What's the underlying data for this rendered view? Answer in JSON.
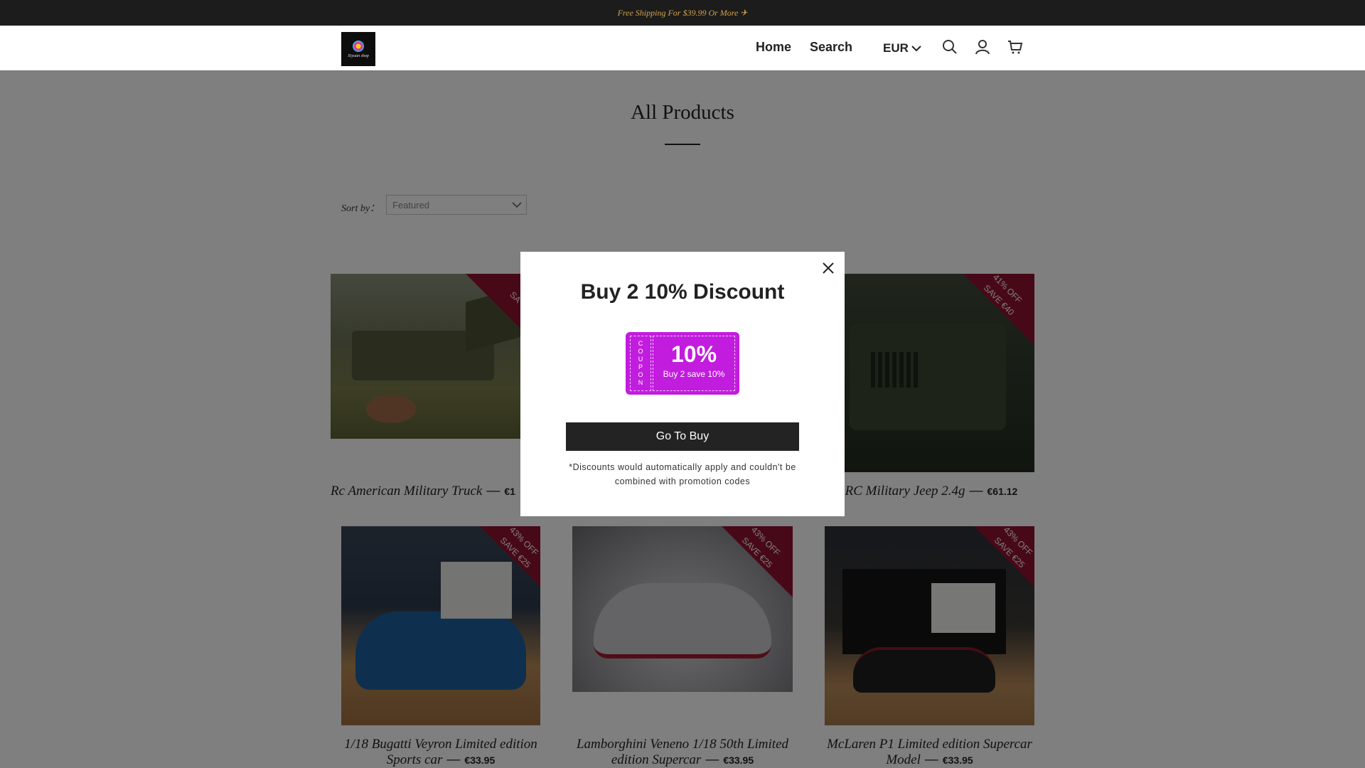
{
  "announcement": "Free Shipping For $39.99 Or More ✈",
  "header": {
    "logo_text": "Xiyuan shop",
    "nav": [
      "Home",
      "Search"
    ],
    "currency": "EUR",
    "icons": [
      "search-icon",
      "account-icon",
      "cart-icon"
    ]
  },
  "page": {
    "title": "All Products",
    "sort_label": "Sort by：",
    "sort_value": "Featured"
  },
  "products": [
    {
      "name": "Rc American Military Truck",
      "price": "€1",
      "badge_off": "",
      "badge_save": "SA"
    },
    {
      "name": "RC Military Jeep 2.4g",
      "price": "€61.12",
      "badge_off": "41% OFF",
      "badge_save": "SAVE €40"
    },
    {
      "name": "1/18 Bugatti Veyron Limited edition Sports car",
      "price": "€33.95",
      "badge_off": "43% OFF",
      "badge_save": "SAVE €25"
    },
    {
      "name": "Lamborghini Veneno 1/18 50th Limited edition Supercar",
      "price": "€33.95",
      "badge_off": "43% OFF",
      "badge_save": "SAVE €25"
    },
    {
      "name": "McLaren P1 Limited edition Supercar Model",
      "price": "€33.95",
      "badge_off": "43% OFF",
      "badge_save": "SAVE €25"
    }
  ],
  "modal": {
    "title": "Buy 2 10% Discount",
    "coupon_stub": "COUPON",
    "coupon_value": "10%",
    "coupon_desc": "Buy 2 save 10%",
    "button": "Go To Buy",
    "note": "*Discounts would automatically apply and couldn't be combined with promotion codes"
  },
  "colors": {
    "announcement_bg": "#1c1c1c",
    "announcement_text": "#d7a24a",
    "ribbon": "#8f1230",
    "coupon": "#c21cde",
    "button": "#232323"
  }
}
